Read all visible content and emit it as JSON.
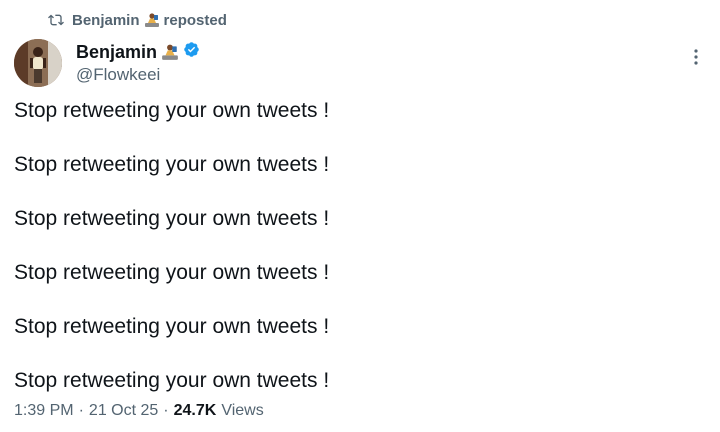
{
  "repost": {
    "icon": "repost-icon",
    "user": "Benjamin",
    "action": "reposted"
  },
  "author": {
    "display_name": "Benjamin",
    "handle": "@Flowkeei",
    "verified": true,
    "verified_color": "#1d9bf0",
    "avatar": "avatar"
  },
  "menu": {
    "icon": "more-options-icon"
  },
  "tweet": {
    "lines": [
      "Stop retweeting your own tweets !",
      "Stop retweeting your own tweets !",
      "Stop retweeting your own tweets !",
      "Stop retweeting your own tweets !",
      "Stop retweeting your own tweets !",
      "Stop retweeting your own tweets !"
    ]
  },
  "meta": {
    "time": "1:39 PM",
    "separator": "·",
    "date": "21 Oct 25",
    "views_count": "24.7K",
    "views_label": "Views"
  },
  "colors": {
    "text_primary": "#0f1419",
    "text_secondary": "#536471",
    "accent": "#1d9bf0"
  }
}
